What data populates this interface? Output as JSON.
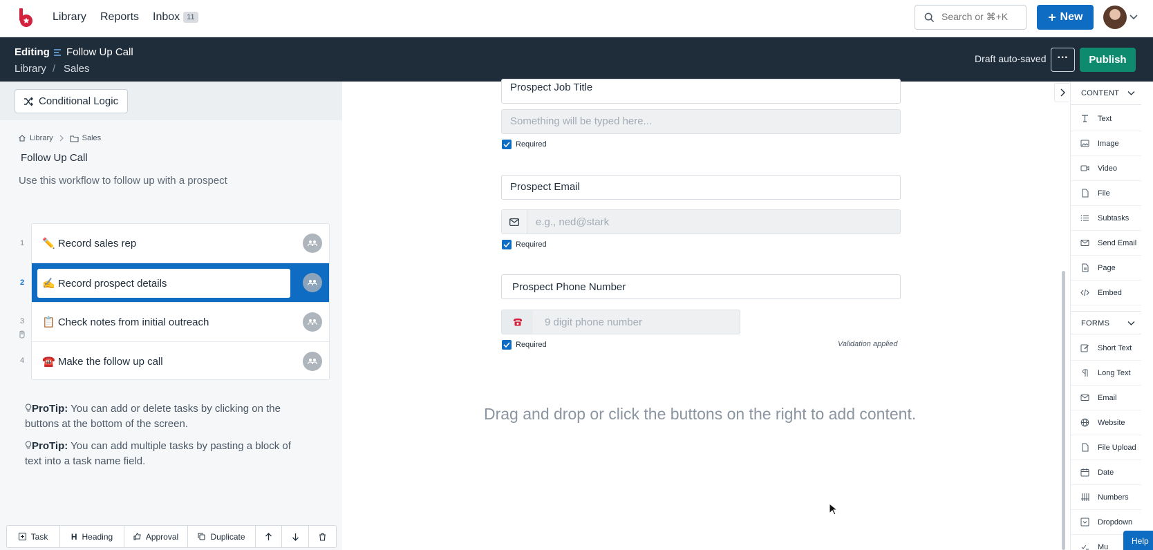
{
  "nav": {
    "links": [
      "Library",
      "Reports",
      "Inbox"
    ],
    "inbox_count": "11",
    "search_placeholder": "Search or ⌘+K",
    "new_label": "New"
  },
  "editbar": {
    "editing_label": "Editing",
    "workflow_title": "Follow Up Call",
    "breadcrumb": [
      "Library",
      "/",
      "Sales"
    ],
    "autosave_text": "Draft auto-saved",
    "more_label": "···",
    "publish_label": "Publish"
  },
  "sidebar": {
    "conditional_logic_label": "Conditional Logic",
    "breadcrumb": [
      "Library",
      "Sales"
    ],
    "title": "Follow Up Call",
    "description": "Use this workflow to follow up with a prospect",
    "tasks": [
      {
        "number": "1",
        "label": "✏️ Record sales rep"
      },
      {
        "number": "2",
        "label": "✍️ Record prospect details"
      },
      {
        "number": "3",
        "label": "📋 Check notes from initial outreach"
      },
      {
        "number": "4",
        "label": "☎️ Make the follow up call"
      }
    ],
    "active_task": 2,
    "protips": [
      {
        "label": "ProTip:",
        "text": " You can add or delete tasks by clicking on the buttons at the bottom of the screen."
      },
      {
        "label": "ProTip:",
        "text": " You can add multiple tasks by pasting a block of text into a task name field."
      }
    ],
    "bottom_buttons": [
      "Task",
      "Heading",
      "Approval",
      "Duplicate"
    ]
  },
  "form": {
    "fields": [
      {
        "label": "Prospect Job Title",
        "placeholder": "Something will be typed here...",
        "required": "Required"
      },
      {
        "label": "Prospect Email",
        "placeholder": "e.g., ned@stark",
        "required": "Required"
      },
      {
        "label": "Prospect Phone Number",
        "placeholder": "9 digit phone number",
        "required": "Required",
        "note": "Validation applied"
      }
    ],
    "dropzone_text": "Drag and drop or click the buttons on the right to add content."
  },
  "right_panel": {
    "content_header": "CONTENT",
    "content_items": [
      {
        "label": "Text",
        "icon": "text-icon"
      },
      {
        "label": "Image",
        "icon": "image-icon"
      },
      {
        "label": "Video",
        "icon": "video-icon"
      },
      {
        "label": "File",
        "icon": "file-icon"
      },
      {
        "label": "Subtasks",
        "icon": "list-icon"
      },
      {
        "label": "Send Email",
        "icon": "mail-icon"
      },
      {
        "label": "Page",
        "icon": "page-icon"
      },
      {
        "label": "Embed",
        "icon": "code-icon"
      }
    ],
    "forms_header": "FORMS",
    "form_items": [
      {
        "label": "Short Text",
        "icon": "edit-icon"
      },
      {
        "label": "Long Text",
        "icon": "paragraph-icon"
      },
      {
        "label": "Email",
        "icon": "mail-icon"
      },
      {
        "label": "Website",
        "icon": "globe-icon"
      },
      {
        "label": "File Upload",
        "icon": "file-icon"
      },
      {
        "label": "Date",
        "icon": "calendar-icon"
      },
      {
        "label": "Numbers",
        "icon": "hash-icon"
      },
      {
        "label": "Dropdown",
        "icon": "dropdown-icon"
      },
      {
        "label": "Mu",
        "icon": "multi-icon"
      }
    ],
    "help_label": "Help"
  },
  "colors": {
    "primary": "#0f6cc3",
    "publish": "#0e8a6e",
    "dark_bar": "#1f2c3a",
    "logo": "#d4213d"
  }
}
